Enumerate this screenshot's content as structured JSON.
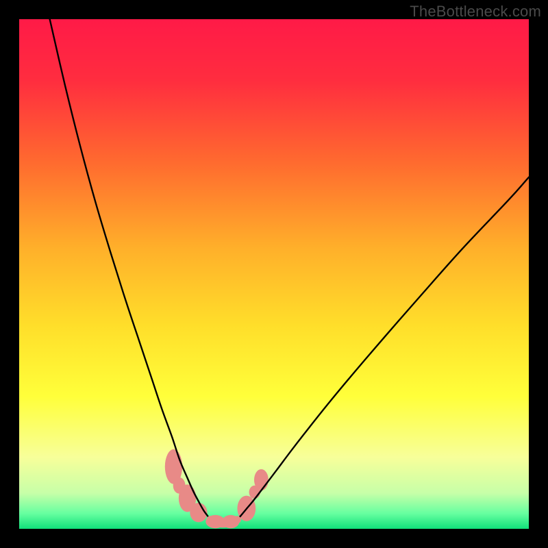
{
  "watermark": "TheBottleneck.com",
  "chart_data": {
    "type": "line",
    "title": "",
    "xlabel": "",
    "ylabel": "",
    "xlim": [
      0,
      100
    ],
    "ylim": [
      0,
      100
    ],
    "background_gradient": {
      "stops": [
        {
          "offset": 0.0,
          "color": "#ff1a47"
        },
        {
          "offset": 0.12,
          "color": "#ff2d3f"
        },
        {
          "offset": 0.28,
          "color": "#ff6a2f"
        },
        {
          "offset": 0.45,
          "color": "#ffb02a"
        },
        {
          "offset": 0.6,
          "color": "#ffde2a"
        },
        {
          "offset": 0.74,
          "color": "#ffff3a"
        },
        {
          "offset": 0.86,
          "color": "#f7ff9a"
        },
        {
          "offset": 0.93,
          "color": "#c7ffa8"
        },
        {
          "offset": 0.97,
          "color": "#66ffa0"
        },
        {
          "offset": 1.0,
          "color": "#11e07a"
        }
      ]
    },
    "series": [
      {
        "name": "left-curve",
        "color": "#000000",
        "x": [
          6.0,
          9.0,
          12.0,
          15.0,
          18.0,
          21.0,
          23.5,
          26.0,
          28.0,
          30.0,
          31.5,
          33.0,
          34.2,
          35.3,
          36.2,
          37.0,
          37.5
        ],
        "y": [
          100.0,
          87.0,
          75.0,
          64.0,
          54.0,
          44.5,
          37.0,
          29.5,
          23.5,
          18.0,
          13.5,
          10.0,
          7.3,
          5.2,
          3.6,
          2.5,
          1.8
        ]
      },
      {
        "name": "right-curve",
        "color": "#000000",
        "x": [
          42.8,
          43.5,
          44.5,
          46.0,
          48.0,
          50.5,
          53.5,
          57.0,
          61.0,
          66.0,
          72.0,
          79.0,
          87.0,
          96.0,
          100.0
        ],
        "y": [
          1.8,
          2.6,
          3.8,
          5.6,
          8.2,
          11.5,
          15.5,
          20.0,
          25.0,
          31.0,
          38.0,
          46.0,
          55.0,
          64.5,
          69.0
        ]
      },
      {
        "name": "bottom-band",
        "color": "#e88a87",
        "x": [
          37.5,
          38.5,
          39.5,
          40.5,
          41.5,
          42.8
        ],
        "y": [
          1.8,
          1.2,
          1.0,
          1.0,
          1.2,
          1.8
        ]
      }
    ],
    "markers": [
      {
        "shape": "blob",
        "cx": 30.3,
        "cy": 12.2,
        "w": 3.4,
        "h": 6.8,
        "color": "#e88a87"
      },
      {
        "shape": "blob",
        "cx": 31.4,
        "cy": 8.5,
        "w": 2.4,
        "h": 3.2,
        "color": "#e88a87"
      },
      {
        "shape": "blob",
        "cx": 33.0,
        "cy": 6.0,
        "w": 3.4,
        "h": 5.4,
        "color": "#e88a87"
      },
      {
        "shape": "blob",
        "cx": 35.2,
        "cy": 3.2,
        "w": 3.4,
        "h": 3.8,
        "color": "#e88a87"
      },
      {
        "shape": "blob",
        "cx": 38.5,
        "cy": 1.4,
        "w": 3.8,
        "h": 2.6,
        "color": "#e88a87"
      },
      {
        "shape": "blob",
        "cx": 41.5,
        "cy": 1.4,
        "w": 3.4,
        "h": 2.6,
        "color": "#e88a87"
      },
      {
        "shape": "blob",
        "cx": 44.6,
        "cy": 4.0,
        "w": 3.6,
        "h": 5.0,
        "color": "#e88a87"
      },
      {
        "shape": "blob",
        "cx": 46.2,
        "cy": 7.2,
        "w": 2.2,
        "h": 2.6,
        "color": "#e88a87"
      },
      {
        "shape": "blob",
        "cx": 47.5,
        "cy": 9.6,
        "w": 2.8,
        "h": 4.2,
        "color": "#e88a87"
      }
    ]
  }
}
